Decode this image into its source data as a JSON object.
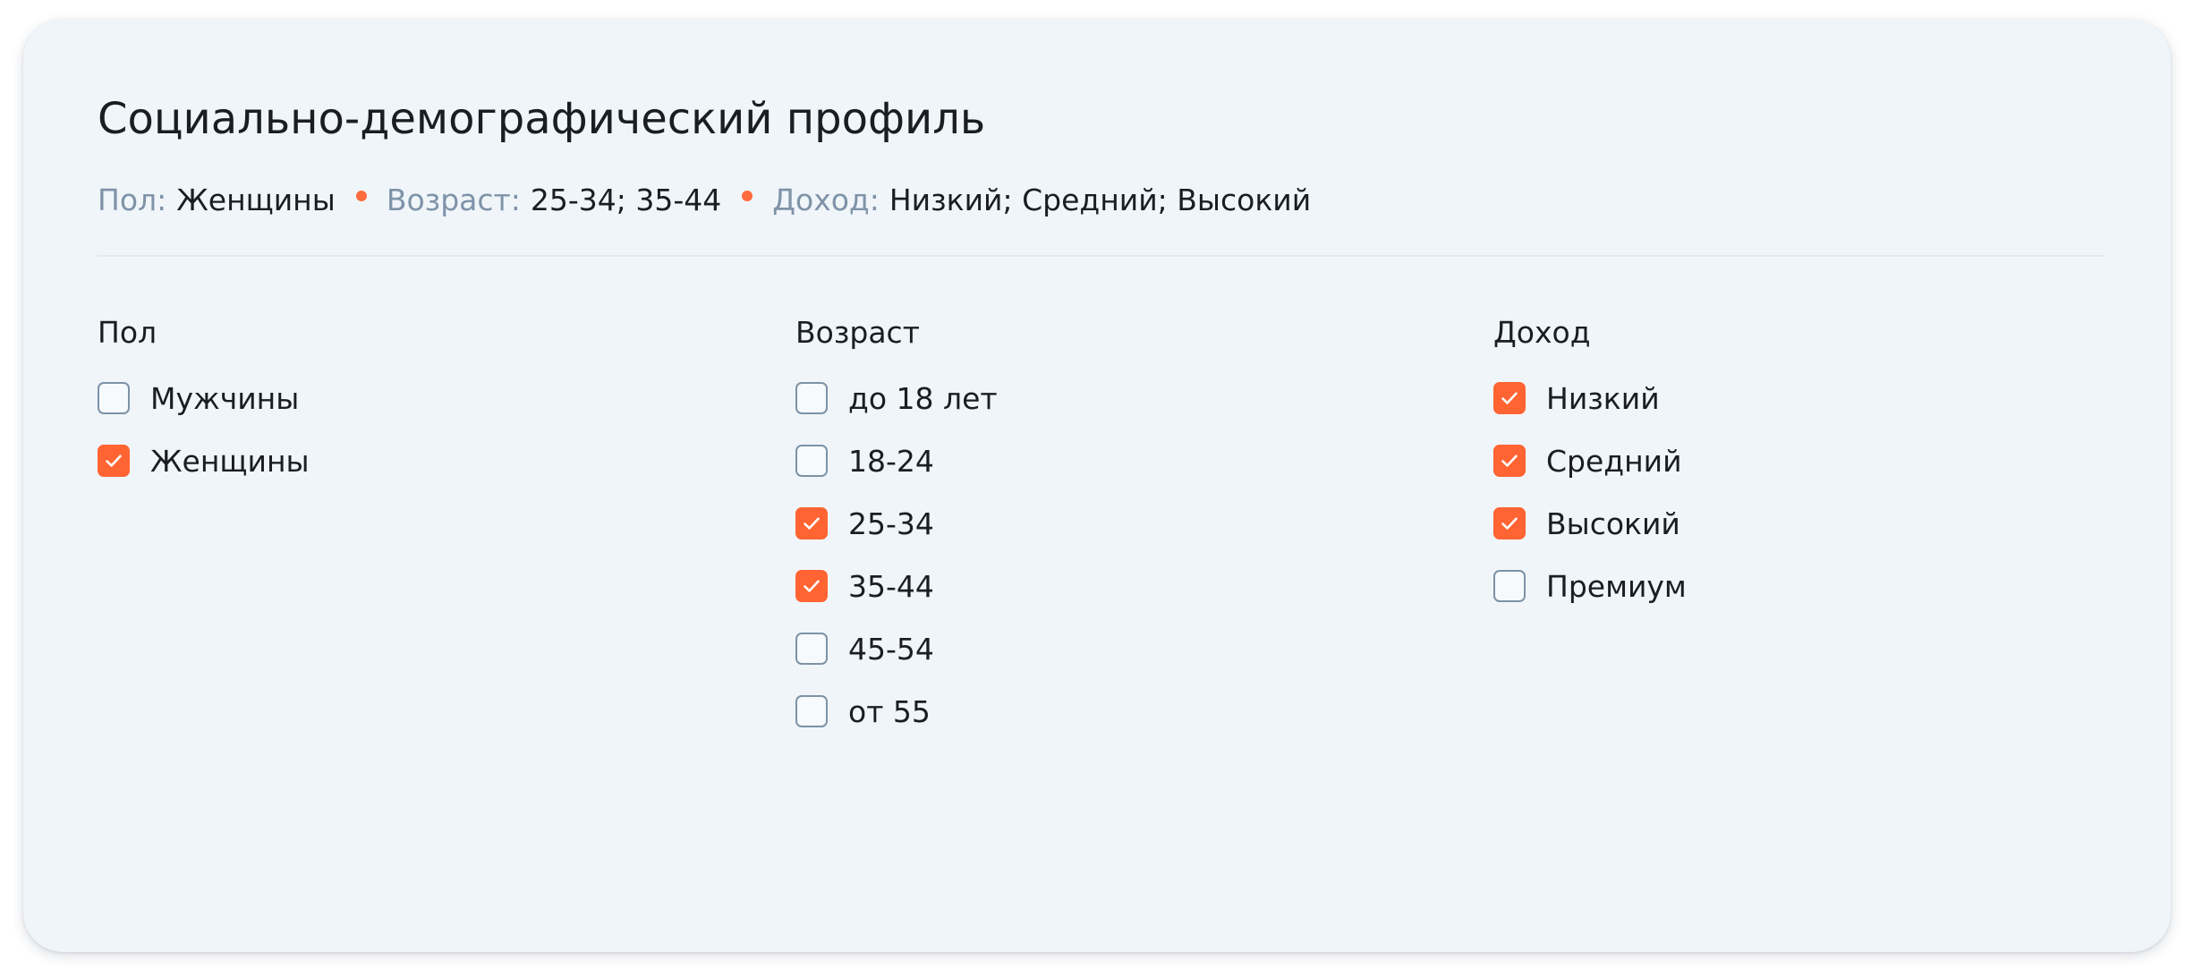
{
  "header": {
    "title": "Социально-демографический профиль"
  },
  "summary": {
    "gender_label": "Пол:",
    "gender_value": "Женщины",
    "age_label": "Возраст:",
    "age_value": "25-34; 35-44",
    "income_label": "Доход:",
    "income_value": "Низкий; Средний; Высокий"
  },
  "colors": {
    "accent": "#ff6432",
    "card_background": "#f0f5fa",
    "muted_label": "#7f93a8"
  },
  "filters": {
    "gender": {
      "title": "Пол",
      "options": [
        {
          "label": "Мужчины",
          "checked": false
        },
        {
          "label": "Женщины",
          "checked": true
        }
      ]
    },
    "age": {
      "title": "Возраст",
      "options": [
        {
          "label": "до 18 лет",
          "checked": false
        },
        {
          "label": "18-24",
          "checked": false
        },
        {
          "label": "25-34",
          "checked": true
        },
        {
          "label": "35-44",
          "checked": true
        },
        {
          "label": "45-54",
          "checked": false
        },
        {
          "label": "от 55",
          "checked": false
        }
      ]
    },
    "income": {
      "title": "Доход",
      "options": [
        {
          "label": "Низкий",
          "checked": true
        },
        {
          "label": "Средний",
          "checked": true
        },
        {
          "label": "Высокий",
          "checked": true
        },
        {
          "label": "Премиум",
          "checked": false
        }
      ]
    }
  }
}
